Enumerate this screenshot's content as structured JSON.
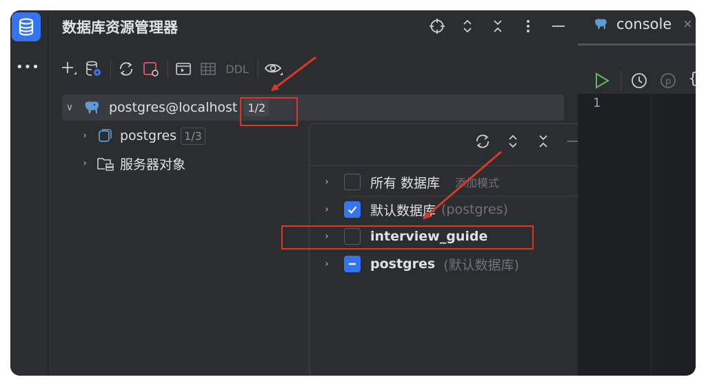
{
  "panel": {
    "title": "数据库资源管理器",
    "header_icons": [
      "crosshair-icon",
      "expand-icon",
      "collapse-icon",
      "more-vertical-icon",
      "minimize-icon"
    ],
    "toolbar": {
      "items": [
        "add-icon",
        "data-source-icon",
        "refresh-icon",
        "stop-icon",
        "console-icon",
        "table-icon"
      ],
      "ddl_label": "DDL",
      "view_icon": "eye-icon"
    }
  },
  "tree": {
    "connection": {
      "name": "postgres@localhost",
      "badge": "1/2"
    },
    "children": [
      {
        "name": "postgres",
        "badge": "1/3"
      },
      {
        "name": "服务器对象"
      }
    ]
  },
  "schema_popup": {
    "items": [
      {
        "label": "所有 数据库",
        "hint": "添加模式",
        "checked": false
      },
      {
        "label": "默认数据库",
        "suffix": "(postgres)",
        "checked": true
      },
      {
        "label": "interview_guide",
        "checked": false,
        "bold": true
      },
      {
        "label": "postgres",
        "suffix": "(默认数据库)",
        "partial": true,
        "bold": true
      }
    ]
  },
  "editor": {
    "tab_label": "console",
    "tab_close": "×",
    "line_number": "1"
  },
  "colors": {
    "accent": "#3574f0",
    "annotation": "#d93a26",
    "run_green": "#5fb865"
  }
}
